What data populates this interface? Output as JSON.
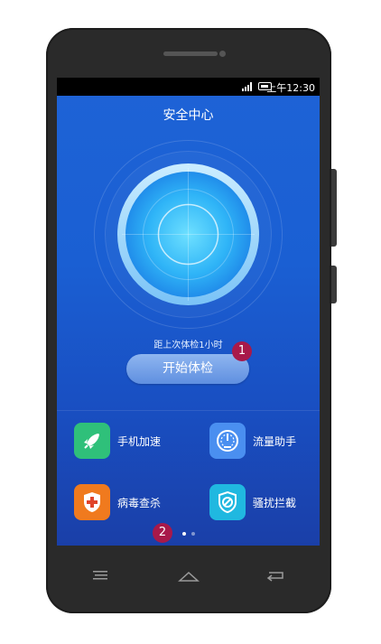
{
  "status_bar": {
    "time": "上午12:30"
  },
  "header": {
    "title": "安全中心"
  },
  "check": {
    "last_check_text": "距上次体检1小时",
    "start_button_label": "开始体检"
  },
  "features": [
    {
      "label": "手机加速",
      "icon": "rocket-icon",
      "color": "#2fc07a"
    },
    {
      "label": "流量助手",
      "icon": "speedometer-icon",
      "color": "#4a8ff0"
    },
    {
      "label": "病毒查杀",
      "icon": "shield-cross-icon",
      "color": "#f07a1e"
    },
    {
      "label": "骚扰拦截",
      "icon": "block-shield-icon",
      "color": "#20b8e0"
    }
  ],
  "pager": {
    "pages": 2,
    "active_page": 1
  },
  "markers": [
    "1",
    "2"
  ],
  "nav": [
    "menu-icon",
    "home-icon",
    "back-icon"
  ],
  "colors": {
    "screen_bg": "#1a5fd3",
    "marker": "#a8194a"
  }
}
